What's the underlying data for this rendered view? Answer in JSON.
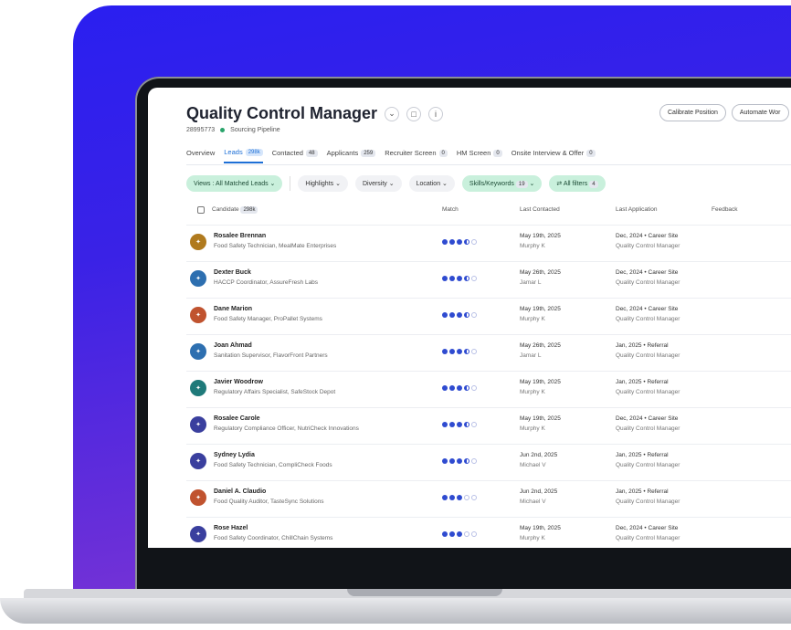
{
  "header": {
    "title": "Quality Control Manager",
    "req_id": "28995773",
    "pipeline": "Sourcing Pipeline",
    "actions": [
      "Calibrate Position",
      "Automate Wor"
    ]
  },
  "tabs": [
    {
      "label": "Overview",
      "count": ""
    },
    {
      "label": "Leads",
      "count": "298k",
      "active": true
    },
    {
      "label": "Contacted",
      "count": "48"
    },
    {
      "label": "Applicants",
      "count": "259"
    },
    {
      "label": "Recruiter Screen",
      "count": "0"
    },
    {
      "label": "HM Screen",
      "count": "0"
    },
    {
      "label": "Onsite Interview & Offer",
      "count": "0"
    }
  ],
  "filters": {
    "views": "Views : All Matched Leads",
    "highlights": "Highlights",
    "diversity": "Diversity",
    "location": "Location",
    "skills": "Skills/Keywords",
    "skills_count": "19",
    "all_filters": "All filters",
    "all_filters_count": "4"
  },
  "columns": {
    "candidate": "Candidate",
    "candidate_count": "298k",
    "match": "Match",
    "last_contacted": "Last Contacted",
    "last_application": "Last Application",
    "feedback": "Feedback"
  },
  "rows": [
    {
      "name": "Rosalee Brennan",
      "role": "Food Safety Technician, MealMate Enterprises",
      "match": 3.5,
      "contacted_date": "May 19th, 2025",
      "contacted_by": "Murphy K",
      "app": "Dec, 2024 • Career Site",
      "app_role": "Quality Control Manager",
      "color": "#b07a1e"
    },
    {
      "name": "Dexter Buck",
      "role": "HACCP Coordinator, AssureFresh Labs",
      "match": 3.5,
      "contacted_date": "May 26th, 2025",
      "contacted_by": "Jamar L",
      "app": "Dec, 2024 • Career Site",
      "app_role": "Quality Control Manager",
      "color": "#2d6fb0"
    },
    {
      "name": "Dane Marion",
      "role": "Food Safety Manager, ProPallet Systems",
      "match": 3.5,
      "contacted_date": "May 19th, 2025",
      "contacted_by": "Murphy K",
      "app": "Dec, 2024 • Career Site",
      "app_role": "Quality Control Manager",
      "color": "#c0532f"
    },
    {
      "name": "Joan Ahmad",
      "role": "Sanitation Supervisor, FlavorFront Partners",
      "match": 3.5,
      "contacted_date": "May 26th, 2025",
      "contacted_by": "Jamar L",
      "app": "Jan, 2025 • Referral",
      "app_role": "Quality Control Manager",
      "color": "#2d6fb0"
    },
    {
      "name": "Javier Woodrow",
      "role": "Regulatory Affairs Specialist, SafeStock Depot",
      "match": 3.5,
      "contacted_date": "May 19th, 2025",
      "contacted_by": "Murphy K",
      "app": "Jan, 2025 • Referral",
      "app_role": "Quality Control Manager",
      "color": "#1f7a7a"
    },
    {
      "name": "Rosalee Carole",
      "role": "Regulatory Compliance Officer, NutriCheck Innovations",
      "match": 3.5,
      "contacted_date": "May 19th, 2025",
      "contacted_by": "Murphy K",
      "app": "Dec, 2024 • Career Site",
      "app_role": "Quality Control Manager",
      "color": "#3a3f9e"
    },
    {
      "name": "Sydney Lydia",
      "role": "Food Safety Technician, CompliCheck Foods",
      "match": 3.5,
      "contacted_date": "Jun 2nd, 2025",
      "contacted_by": "Michael V",
      "app": "Jan, 2025 • Referral",
      "app_role": "Quality Control Manager",
      "color": "#3a3f9e"
    },
    {
      "name": "Daniel A. Claudio",
      "role": "Food Quality Auditor, TasteSync Solutions",
      "match": 3,
      "contacted_date": "Jun 2nd, 2025",
      "contacted_by": "Michael V",
      "app": "Jan, 2025 • Referral",
      "app_role": "Quality Control Manager",
      "color": "#c0532f"
    },
    {
      "name": "Rose Hazel",
      "role": "Food Safety Coordinator, ChillChain Systems",
      "match": 3,
      "contacted_date": "May 19th, 2025",
      "contacted_by": "Murphy K",
      "app": "Dec, 2024 • Career Site",
      "app_role": "Quality Control Manager",
      "color": "#3a3f9e"
    }
  ]
}
